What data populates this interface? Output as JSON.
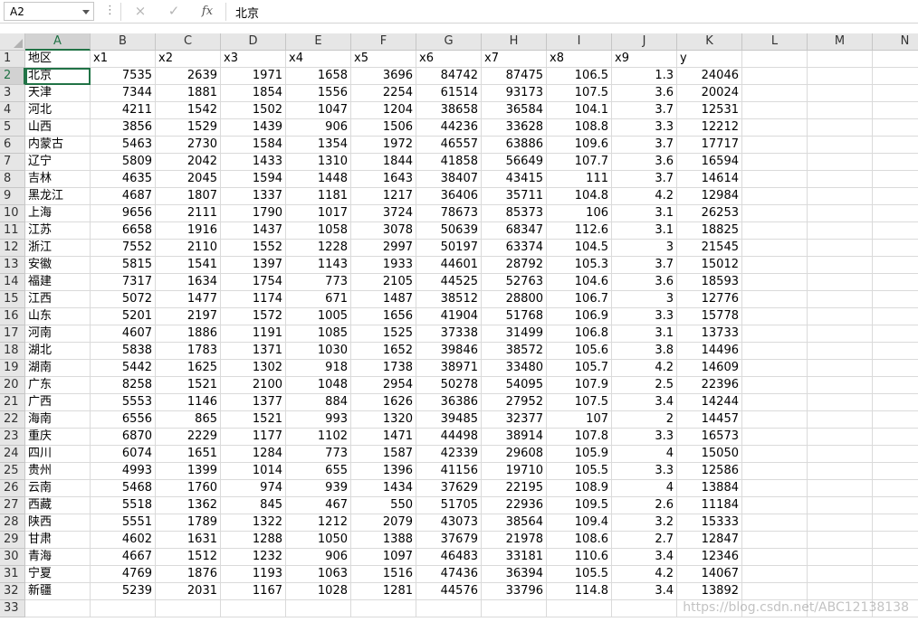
{
  "formula_bar": {
    "name_box": "A2",
    "cancel_icon": "×",
    "enter_icon": "✓",
    "fx_label": "fx",
    "content": "北京"
  },
  "sheet": {
    "columns": [
      "A",
      "B",
      "C",
      "D",
      "E",
      "F",
      "G",
      "H",
      "I",
      "J",
      "K",
      "L",
      "M",
      "N"
    ],
    "row_numbers": [
      1,
      2,
      3,
      4,
      5,
      6,
      7,
      8,
      9,
      10,
      11,
      12,
      13,
      14,
      15,
      16,
      17,
      18,
      19,
      20,
      21,
      22,
      23,
      24,
      25,
      26,
      27,
      28,
      29,
      30,
      31,
      32,
      33
    ],
    "selected_cell": "A2",
    "header_row": [
      "地区",
      "x1",
      "x2",
      "x3",
      "x4",
      "x5",
      "x6",
      "x7",
      "x8",
      "x9",
      "y"
    ],
    "rows": [
      [
        "北京",
        "7535",
        "2639",
        "1971",
        "1658",
        "3696",
        "84742",
        "87475",
        "106.5",
        "1.3",
        "24046"
      ],
      [
        "天津",
        "7344",
        "1881",
        "1854",
        "1556",
        "2254",
        "61514",
        "93173",
        "107.5",
        "3.6",
        "20024"
      ],
      [
        "河北",
        "4211",
        "1542",
        "1502",
        "1047",
        "1204",
        "38658",
        "36584",
        "104.1",
        "3.7",
        "12531"
      ],
      [
        "山西",
        "3856",
        "1529",
        "1439",
        "906",
        "1506",
        "44236",
        "33628",
        "108.8",
        "3.3",
        "12212"
      ],
      [
        "内蒙古",
        "5463",
        "2730",
        "1584",
        "1354",
        "1972",
        "46557",
        "63886",
        "109.6",
        "3.7",
        "17717"
      ],
      [
        "辽宁",
        "5809",
        "2042",
        "1433",
        "1310",
        "1844",
        "41858",
        "56649",
        "107.7",
        "3.6",
        "16594"
      ],
      [
        "吉林",
        "4635",
        "2045",
        "1594",
        "1448",
        "1643",
        "38407",
        "43415",
        "111",
        "3.7",
        "14614"
      ],
      [
        "黑龙江",
        "4687",
        "1807",
        "1337",
        "1181",
        "1217",
        "36406",
        "35711",
        "104.8",
        "4.2",
        "12984"
      ],
      [
        "上海",
        "9656",
        "2111",
        "1790",
        "1017",
        "3724",
        "78673",
        "85373",
        "106",
        "3.1",
        "26253"
      ],
      [
        "江苏",
        "6658",
        "1916",
        "1437",
        "1058",
        "3078",
        "50639",
        "68347",
        "112.6",
        "3.1",
        "18825"
      ],
      [
        "浙江",
        "7552",
        "2110",
        "1552",
        "1228",
        "2997",
        "50197",
        "63374",
        "104.5",
        "3",
        "21545"
      ],
      [
        "安徽",
        "5815",
        "1541",
        "1397",
        "1143",
        "1933",
        "44601",
        "28792",
        "105.3",
        "3.7",
        "15012"
      ],
      [
        "福建",
        "7317",
        "1634",
        "1754",
        "773",
        "2105",
        "44525",
        "52763",
        "104.6",
        "3.6",
        "18593"
      ],
      [
        "江西",
        "5072",
        "1477",
        "1174",
        "671",
        "1487",
        "38512",
        "28800",
        "106.7",
        "3",
        "12776"
      ],
      [
        "山东",
        "5201",
        "2197",
        "1572",
        "1005",
        "1656",
        "41904",
        "51768",
        "106.9",
        "3.3",
        "15778"
      ],
      [
        "河南",
        "4607",
        "1886",
        "1191",
        "1085",
        "1525",
        "37338",
        "31499",
        "106.8",
        "3.1",
        "13733"
      ],
      [
        "湖北",
        "5838",
        "1783",
        "1371",
        "1030",
        "1652",
        "39846",
        "38572",
        "105.6",
        "3.8",
        "14496"
      ],
      [
        "湖南",
        "5442",
        "1625",
        "1302",
        "918",
        "1738",
        "38971",
        "33480",
        "105.7",
        "4.2",
        "14609"
      ],
      [
        "广东",
        "8258",
        "1521",
        "2100",
        "1048",
        "2954",
        "50278",
        "54095",
        "107.9",
        "2.5",
        "22396"
      ],
      [
        "广西",
        "5553",
        "1146",
        "1377",
        "884",
        "1626",
        "36386",
        "27952",
        "107.5",
        "3.4",
        "14244"
      ],
      [
        "海南",
        "6556",
        "865",
        "1521",
        "993",
        "1320",
        "39485",
        "32377",
        "107",
        "2",
        "14457"
      ],
      [
        "重庆",
        "6870",
        "2229",
        "1177",
        "1102",
        "1471",
        "44498",
        "38914",
        "107.8",
        "3.3",
        "16573"
      ],
      [
        "四川",
        "6074",
        "1651",
        "1284",
        "773",
        "1587",
        "42339",
        "29608",
        "105.9",
        "4",
        "15050"
      ],
      [
        "贵州",
        "4993",
        "1399",
        "1014",
        "655",
        "1396",
        "41156",
        "19710",
        "105.5",
        "3.3",
        "12586"
      ],
      [
        "云南",
        "5468",
        "1760",
        "974",
        "939",
        "1434",
        "37629",
        "22195",
        "108.9",
        "4",
        "13884"
      ],
      [
        "西藏",
        "5518",
        "1362",
        "845",
        "467",
        "550",
        "51705",
        "22936",
        "109.5",
        "2.6",
        "11184"
      ],
      [
        "陕西",
        "5551",
        "1789",
        "1322",
        "1212",
        "2079",
        "43073",
        "38564",
        "109.4",
        "3.2",
        "15333"
      ],
      [
        "甘肃",
        "4602",
        "1631",
        "1288",
        "1050",
        "1388",
        "37679",
        "21978",
        "108.6",
        "2.7",
        "12847"
      ],
      [
        "青海",
        "4667",
        "1512",
        "1232",
        "906",
        "1097",
        "46483",
        "33181",
        "110.6",
        "3.4",
        "12346"
      ],
      [
        "宁夏",
        "4769",
        "1876",
        "1193",
        "1063",
        "1516",
        "47436",
        "36394",
        "105.5",
        "4.2",
        "14067"
      ],
      [
        "新疆",
        "5239",
        "2031",
        "1167",
        "1028",
        "1281",
        "44576",
        "33796",
        "114.8",
        "3.4",
        "13892"
      ]
    ]
  },
  "watermark": "https://blog.csdn.net/ABC12138138"
}
